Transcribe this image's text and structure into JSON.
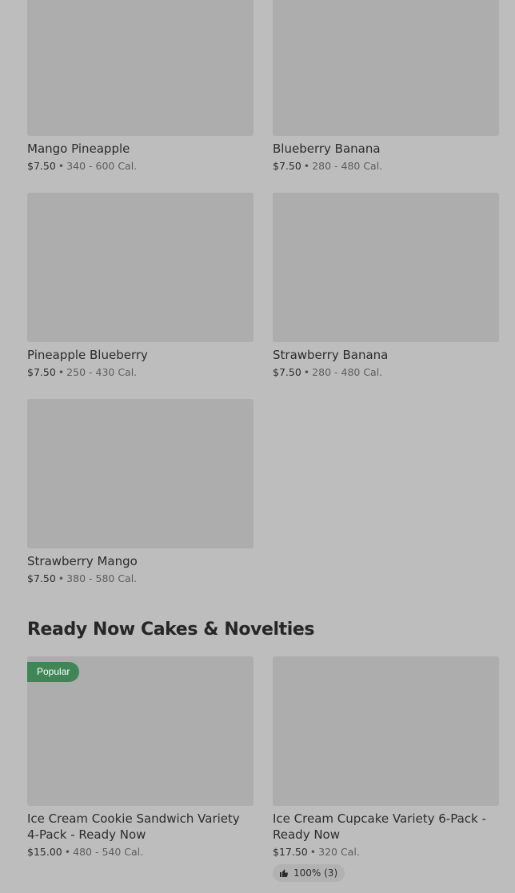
{
  "items_top": [
    {
      "name": "Mango Pineapple",
      "price": "$7.50",
      "sep": "•",
      "calories": "340 - 600 Cal."
    },
    {
      "name": "Blueberry Banana",
      "price": "$7.50",
      "sep": "•",
      "calories": "280 - 480 Cal."
    },
    {
      "name": "Pineapple Blueberry",
      "price": "$7.50",
      "sep": "•",
      "calories": "250 - 430 Cal."
    },
    {
      "name": "Strawberry Banana",
      "price": "$7.50",
      "sep": "•",
      "calories": "280 - 480 Cal."
    },
    {
      "name": "Strawberry Mango",
      "price": "$7.50",
      "sep": "•",
      "calories": "380 - 580 Cal."
    }
  ],
  "section": {
    "title": "Ready Now Cakes & Novelties",
    "items": [
      {
        "name": "Ice Cream Cookie Sandwich Variety 4-Pack - Ready Now",
        "price": "$15.00",
        "sep": "•",
        "calories": "480 - 540 Cal.",
        "badge": "Popular"
      },
      {
        "name": "Ice Cream Cupcake Variety 6-Pack - Ready Now",
        "price": "$17.50",
        "sep": "•",
        "calories": "320 Cal.",
        "rating": "100% (3)",
        "rating_icon": "thumbs-up-icon"
      }
    ]
  },
  "colors": {
    "background": "#bdbdbd",
    "placeholder": "#adadad",
    "badge": "#3f8556"
  }
}
